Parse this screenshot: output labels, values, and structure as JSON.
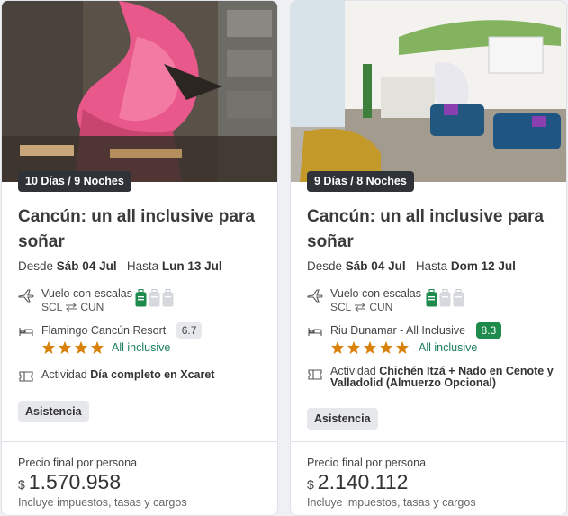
{
  "cards": [
    {
      "duration": "10 Días / 9 Noches",
      "title": "Cancún: un all inclusive para soñar",
      "dates": {
        "from_label": "Desde",
        "from_date": "Sáb 04 Jul",
        "to_label": "Hasta",
        "to_date": "Lun 13 Jul"
      },
      "flight": {
        "label": "Vuelo con escalas",
        "origin": "SCL",
        "destination": "CUN"
      },
      "hotel": {
        "name": "Flamingo Cancún Resort",
        "rating": "6.7",
        "stars": 4,
        "plan": "All inclusive"
      },
      "activity": {
        "label": "Actividad",
        "name": "Día completo en Xcaret"
      },
      "tag": "Asistencia",
      "price": {
        "label": "Precio final por persona",
        "currency": "$",
        "amount": "1.570.958",
        "note": "Incluye impuestos, tasas y cargos"
      },
      "image": "flamingo-mural-photo"
    },
    {
      "duration": "9 Días / 8 Noches",
      "title": "Cancún: un all inclusive para soñar",
      "dates": {
        "from_label": "Desde",
        "from_date": "Sáb 04 Jul",
        "to_label": "Hasta",
        "to_date": "Dom 12 Jul"
      },
      "flight": {
        "label": "Vuelo con escalas",
        "origin": "SCL",
        "destination": "CUN"
      },
      "hotel": {
        "name": "Riu Dunamar - All Inclusive",
        "rating": "8.3",
        "stars": 5,
        "plan": "All inclusive"
      },
      "activity": {
        "label": "Actividad",
        "name": "Chichén Itzá + Nado en Cenote y Valladolid (Almuerzo Opcional)"
      },
      "tag": "Asistencia",
      "price": {
        "label": "Precio final por persona",
        "currency": "$",
        "amount": "2.140.112",
        "note": "Incluye impuestos, tasas y cargos"
      },
      "image": "hotel-lobby-photo"
    }
  ],
  "colors": {
    "accent_green": "#1e8a4b",
    "star": "#d9820b",
    "link_green": "#1a7f5a"
  },
  "icons": [
    "plane-icon",
    "swap-arrows-icon",
    "bag-included-icon",
    "bag-not-included-icon",
    "bed-icon",
    "star-icon",
    "ticket-icon"
  ]
}
